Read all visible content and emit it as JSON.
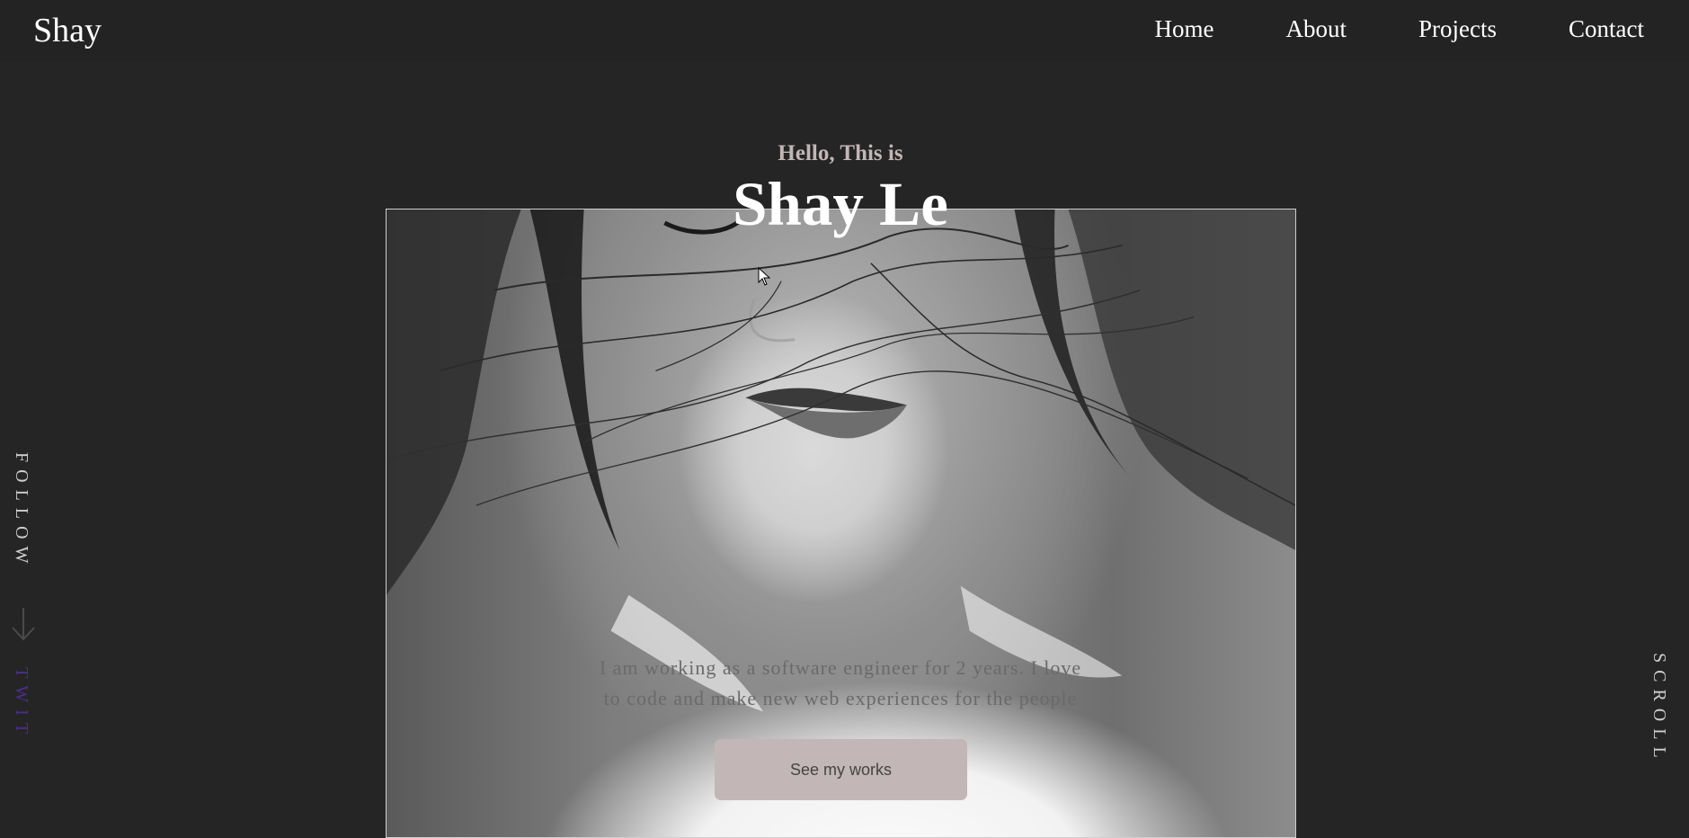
{
  "nav": {
    "brand": "Shay",
    "links": [
      "Home",
      "About",
      "Projects",
      "Contact"
    ]
  },
  "hero": {
    "greeting": "Hello, This is",
    "name": "Shay Le",
    "intro_line1": "I am working as a software engineer for 2 years. I love",
    "intro_line2": "to code and make new web experiences for the people",
    "cta_label": "See my works"
  },
  "side": {
    "follow_label": "FOLLOW",
    "social_label": "TWIT",
    "scroll_label": "SCROLL"
  },
  "colors": {
    "background": "#252525",
    "accent": "#c2b6b6",
    "social_link": "#4b2e8c"
  }
}
